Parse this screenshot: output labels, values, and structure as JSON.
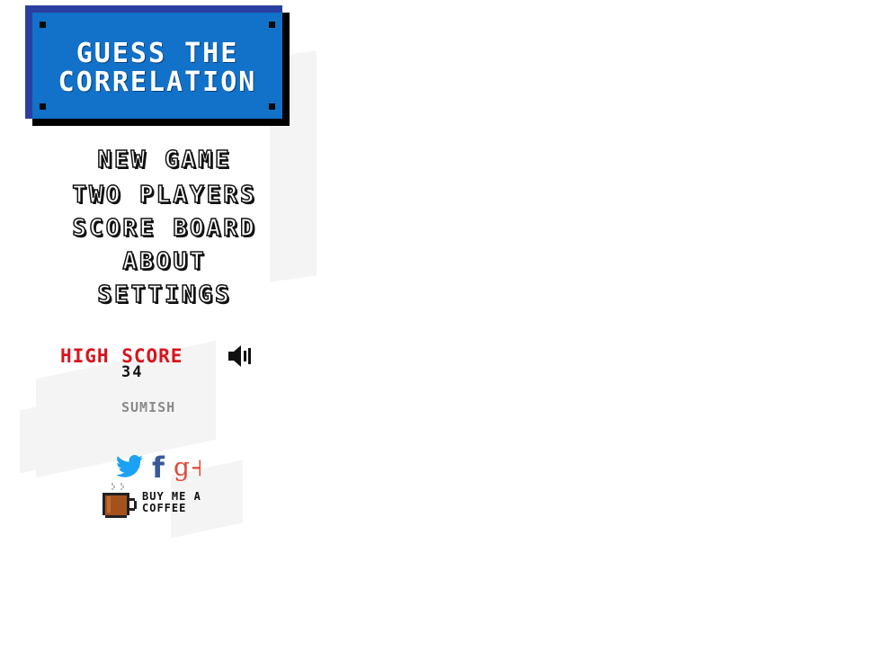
{
  "logo": {
    "line1": "GUESS THE",
    "line2": "CORRELATION"
  },
  "menu": {
    "items": [
      {
        "label": "NEW GAME"
      },
      {
        "label": "TWO PLAYERS"
      },
      {
        "label": "SCORE BOARD"
      },
      {
        "label": "ABOUT"
      },
      {
        "label": "SETTINGS"
      }
    ]
  },
  "score": {
    "label": "HIGH SCORE",
    "value": "34"
  },
  "sound": {
    "icon": "speaker-icon"
  },
  "credit": "SUMISH",
  "social": {
    "icons": [
      "twitter-icon",
      "facebook-icon",
      "google-plus-icon"
    ],
    "facebook_glyph": "f",
    "google_glyph": "g+"
  },
  "coffee": {
    "line1": "BUY ME A",
    "line2": "COFFEE",
    "icon": "coffee-cup-icon"
  },
  "colors": {
    "logo_blue": "#1271c9",
    "logo_border": "#2a3fa0",
    "high_score_red": "#d8141e",
    "twitter_blue": "#1da1f2",
    "facebook_blue": "#3b5998",
    "google_red": "#dd4b39",
    "coffee_brown": "#a4521c"
  }
}
